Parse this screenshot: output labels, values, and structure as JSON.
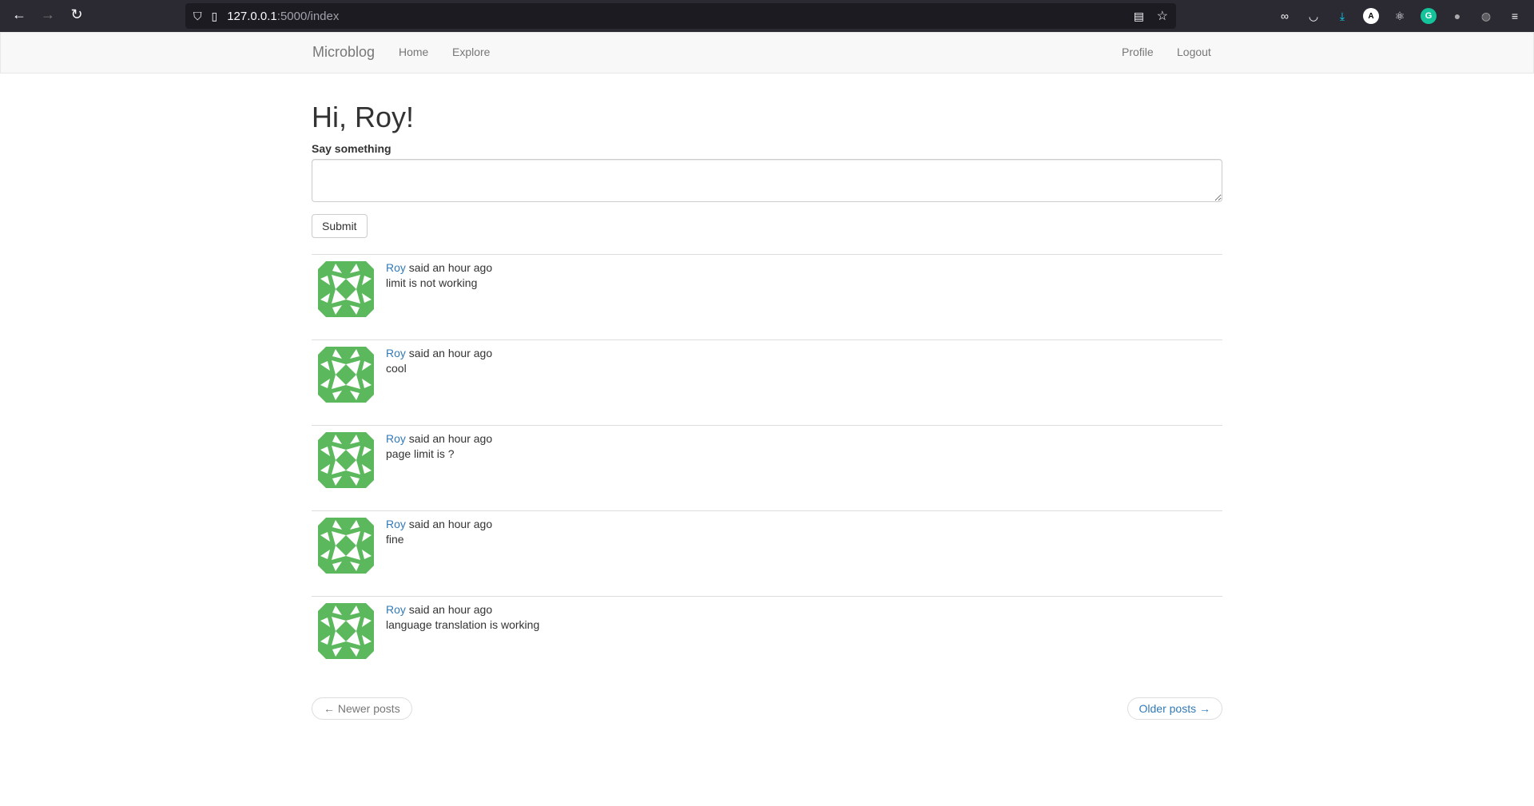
{
  "browser": {
    "url_host": "127.0.0.1",
    "url_path": ":5000/index"
  },
  "nav": {
    "brand": "Microblog",
    "home": "Home",
    "explore": "Explore",
    "profile": "Profile",
    "logout": "Logout"
  },
  "main": {
    "greeting": "Hi, Roy!",
    "form_label": "Say something",
    "textarea_value": "",
    "submit": "Submit"
  },
  "posts": [
    {
      "author": "Roy",
      "when": " said an hour ago",
      "body": "limit is not working"
    },
    {
      "author": "Roy",
      "when": " said an hour ago",
      "body": "cool"
    },
    {
      "author": "Roy",
      "when": " said an hour ago",
      "body": "page limit is ?"
    },
    {
      "author": "Roy",
      "when": " said an hour ago",
      "body": "fine"
    },
    {
      "author": "Roy",
      "when": " said an hour ago",
      "body": "language translation is working"
    }
  ],
  "pager": {
    "newer": "← Newer posts",
    "older": "Older posts →"
  },
  "colors": {
    "avatar": "#5cb85c",
    "link": "#337ab7"
  }
}
